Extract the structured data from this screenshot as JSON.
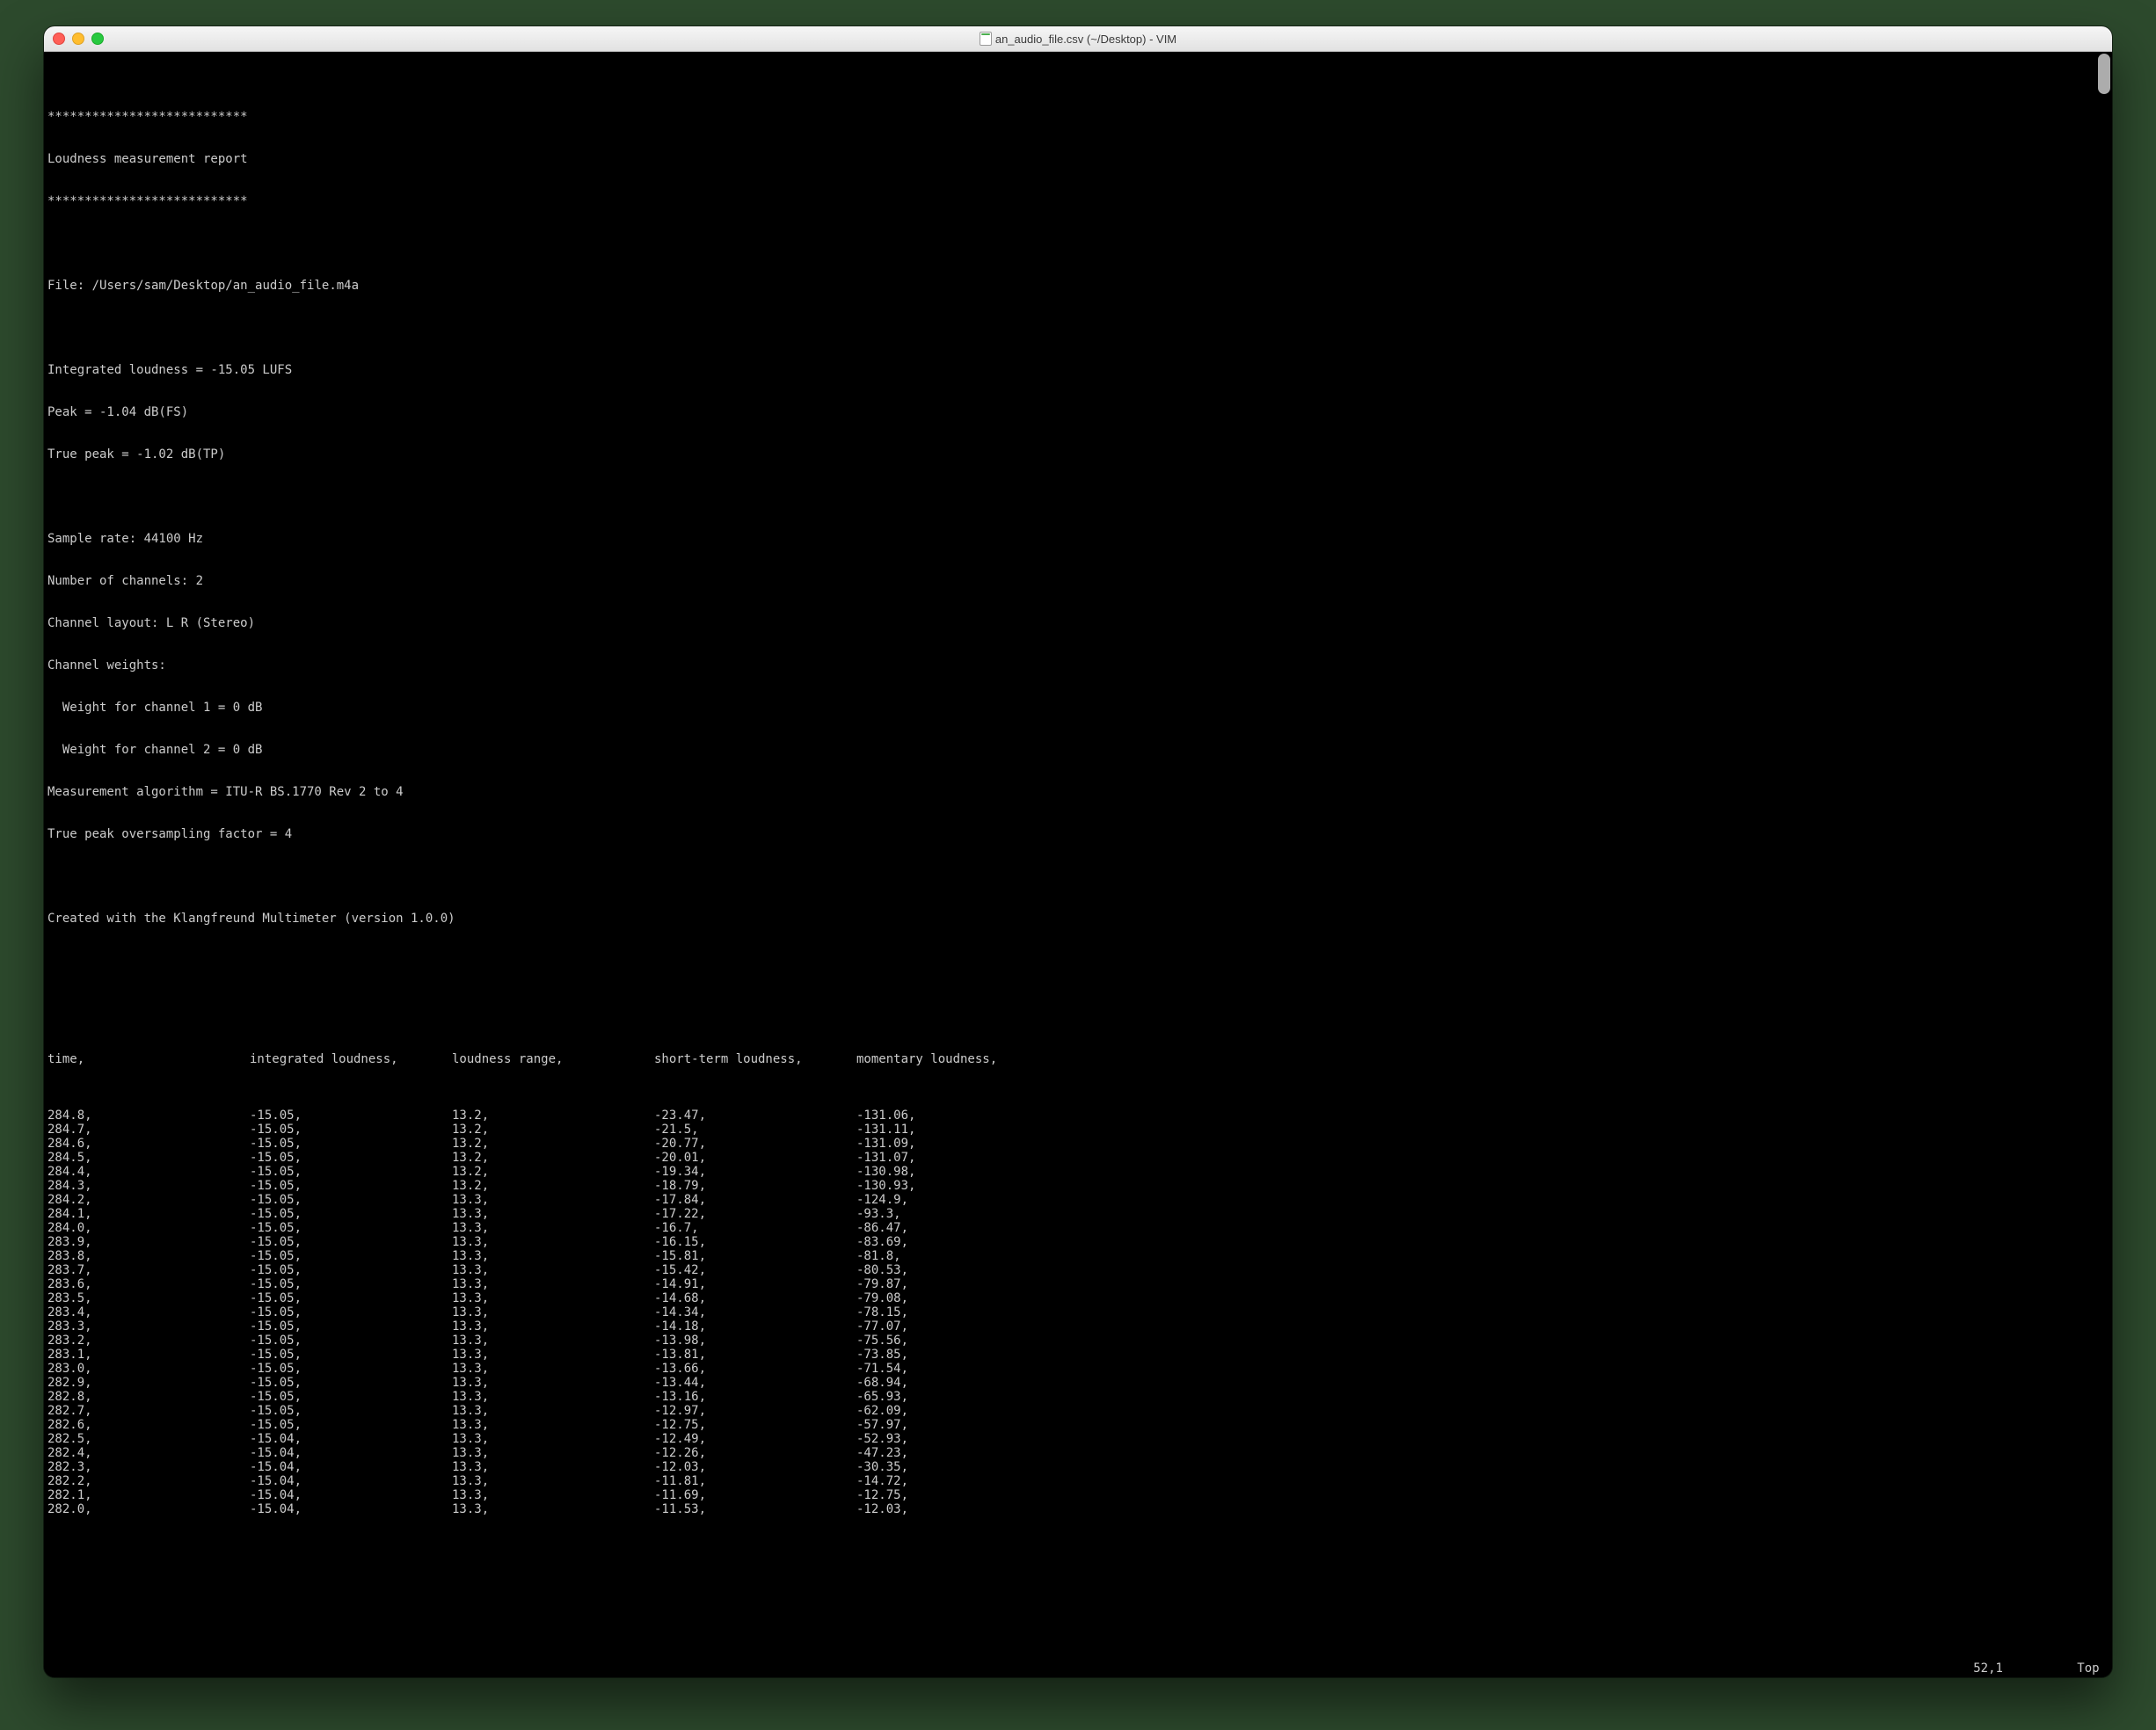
{
  "window": {
    "title": "an_audio_file.csv (~/Desktop) - VIM"
  },
  "header": {
    "rule": "***************************",
    "title": "Loudness measurement report",
    "file_label": "File:",
    "file_path": "/Users/sam/Desktop/an_audio_file.m4a",
    "integrated": "Integrated loudness = -15.05 LUFS",
    "peak": "Peak = -1.04 dB(FS)",
    "true_peak": "True peak = -1.02 dB(TP)",
    "sample_rate": "Sample rate: 44100 Hz",
    "channels": "Number of channels: 2",
    "layout": "Channel layout: L R (Stereo)",
    "weights_label": "Channel weights:",
    "weight1": "  Weight for channel 1 = 0 dB",
    "weight2": "  Weight for channel 2 = 0 dB",
    "algorithm": "Measurement algorithm = ITU-R BS.1770 Rev 2 to 4",
    "oversampling": "True peak oversampling factor = 4",
    "created": "Created with the Klangfreund Multimeter (version 1.0.0)"
  },
  "columns": [
    "time,",
    "integrated loudness,",
    "loudness range,",
    "short-term loudness,",
    "momentary loudness,"
  ],
  "rows": [
    [
      "284.8,",
      "-15.05,",
      "13.2,",
      "-23.47,",
      "-131.06,"
    ],
    [
      "284.7,",
      "-15.05,",
      "13.2,",
      "-21.5,",
      "-131.11,"
    ],
    [
      "284.6,",
      "-15.05,",
      "13.2,",
      "-20.77,",
      "-131.09,"
    ],
    [
      "284.5,",
      "-15.05,",
      "13.2,",
      "-20.01,",
      "-131.07,"
    ],
    [
      "284.4,",
      "-15.05,",
      "13.2,",
      "-19.34,",
      "-130.98,"
    ],
    [
      "284.3,",
      "-15.05,",
      "13.2,",
      "-18.79,",
      "-130.93,"
    ],
    [
      "284.2,",
      "-15.05,",
      "13.3,",
      "-17.84,",
      "-124.9,"
    ],
    [
      "284.1,",
      "-15.05,",
      "13.3,",
      "-17.22,",
      "-93.3,"
    ],
    [
      "284.0,",
      "-15.05,",
      "13.3,",
      "-16.7,",
      "-86.47,"
    ],
    [
      "283.9,",
      "-15.05,",
      "13.3,",
      "-16.15,",
      "-83.69,"
    ],
    [
      "283.8,",
      "-15.05,",
      "13.3,",
      "-15.81,",
      "-81.8,"
    ],
    [
      "283.7,",
      "-15.05,",
      "13.3,",
      "-15.42,",
      "-80.53,"
    ],
    [
      "283.6,",
      "-15.05,",
      "13.3,",
      "-14.91,",
      "-79.87,"
    ],
    [
      "283.5,",
      "-15.05,",
      "13.3,",
      "-14.68,",
      "-79.08,"
    ],
    [
      "283.4,",
      "-15.05,",
      "13.3,",
      "-14.34,",
      "-78.15,"
    ],
    [
      "283.3,",
      "-15.05,",
      "13.3,",
      "-14.18,",
      "-77.07,"
    ],
    [
      "283.2,",
      "-15.05,",
      "13.3,",
      "-13.98,",
      "-75.56,"
    ],
    [
      "283.1,",
      "-15.05,",
      "13.3,",
      "-13.81,",
      "-73.85,"
    ],
    [
      "283.0,",
      "-15.05,",
      "13.3,",
      "-13.66,",
      "-71.54,"
    ],
    [
      "282.9,",
      "-15.05,",
      "13.3,",
      "-13.44,",
      "-68.94,"
    ],
    [
      "282.8,",
      "-15.05,",
      "13.3,",
      "-13.16,",
      "-65.93,"
    ],
    [
      "282.7,",
      "-15.05,",
      "13.3,",
      "-12.97,",
      "-62.09,"
    ],
    [
      "282.6,",
      "-15.05,",
      "13.3,",
      "-12.75,",
      "-57.97,"
    ],
    [
      "282.5,",
      "-15.04,",
      "13.3,",
      "-12.49,",
      "-52.93,"
    ],
    [
      "282.4,",
      "-15.04,",
      "13.3,",
      "-12.26,",
      "-47.23,"
    ],
    [
      "282.3,",
      "-15.04,",
      "13.3,",
      "-12.03,",
      "-30.35,"
    ],
    [
      "282.2,",
      "-15.04,",
      "13.3,",
      "-11.81,",
      "-14.72,"
    ],
    [
      "282.1,",
      "-15.04,",
      "13.3,",
      "-11.69,",
      "-12.75,"
    ],
    [
      "282.0,",
      "-15.04,",
      "13.3,",
      "-11.53,",
      "-12.03,"
    ]
  ],
  "status": {
    "pos": "52,1",
    "scroll": "Top"
  }
}
